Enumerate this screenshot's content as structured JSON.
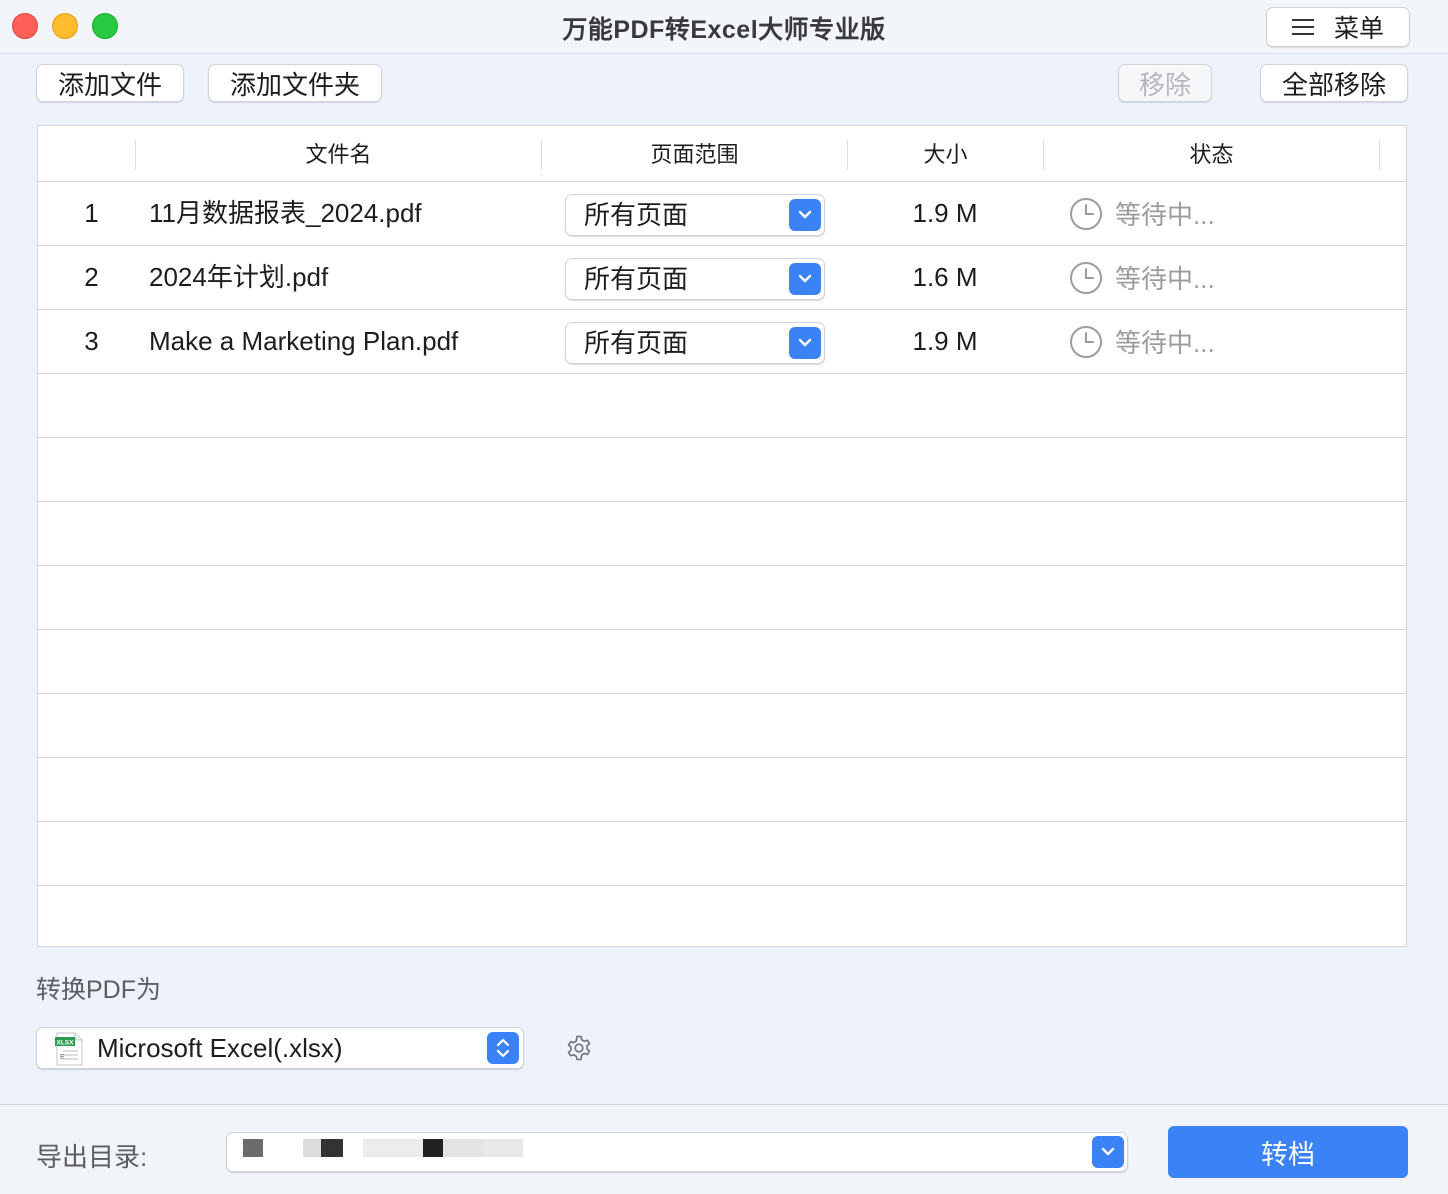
{
  "window": {
    "title": "万能PDF转Excel大师专业版",
    "menu_label": "菜单"
  },
  "toolbar": {
    "add_file": "添加文件",
    "add_folder": "添加文件夹",
    "remove": "移除",
    "remove_all": "全部移除"
  },
  "table": {
    "headers": {
      "index": "",
      "name": "文件名",
      "range": "页面范围",
      "size": "大小",
      "status": "状态"
    },
    "rows": [
      {
        "index": "1",
        "name": "11月数据报表_2024.pdf",
        "range": "所有页面",
        "size": "1.9 M",
        "status": "等待中..."
      },
      {
        "index": "2",
        "name": "2024年计划.pdf",
        "range": "所有页面",
        "size": "1.6 M",
        "status": "等待中..."
      },
      {
        "index": "3",
        "name": "Make a Marketing Plan.pdf",
        "range": "所有页面",
        "size": "1.9 M",
        "status": "等待中..."
      }
    ]
  },
  "convert": {
    "label": "转换PDF为",
    "format": "Microsoft Excel(.xlsx)",
    "icon_text": "XLSX"
  },
  "export": {
    "label": "导出目录:",
    "path": ""
  },
  "actions": {
    "convert_button": "转档"
  },
  "colors": {
    "accent": "#3b82f6",
    "status_gray": "#9a9ca1",
    "traffic_red": "#fe5f57",
    "traffic_yellow": "#febc2e",
    "traffic_green": "#28c840"
  },
  "icons": {
    "menu": "hamburger-icon",
    "dropdown": "chevron-down-icon",
    "status": "clock-icon",
    "settings": "gear-icon",
    "format": "xlsx-file-icon",
    "stepper": "up-down-chevron-icon"
  }
}
